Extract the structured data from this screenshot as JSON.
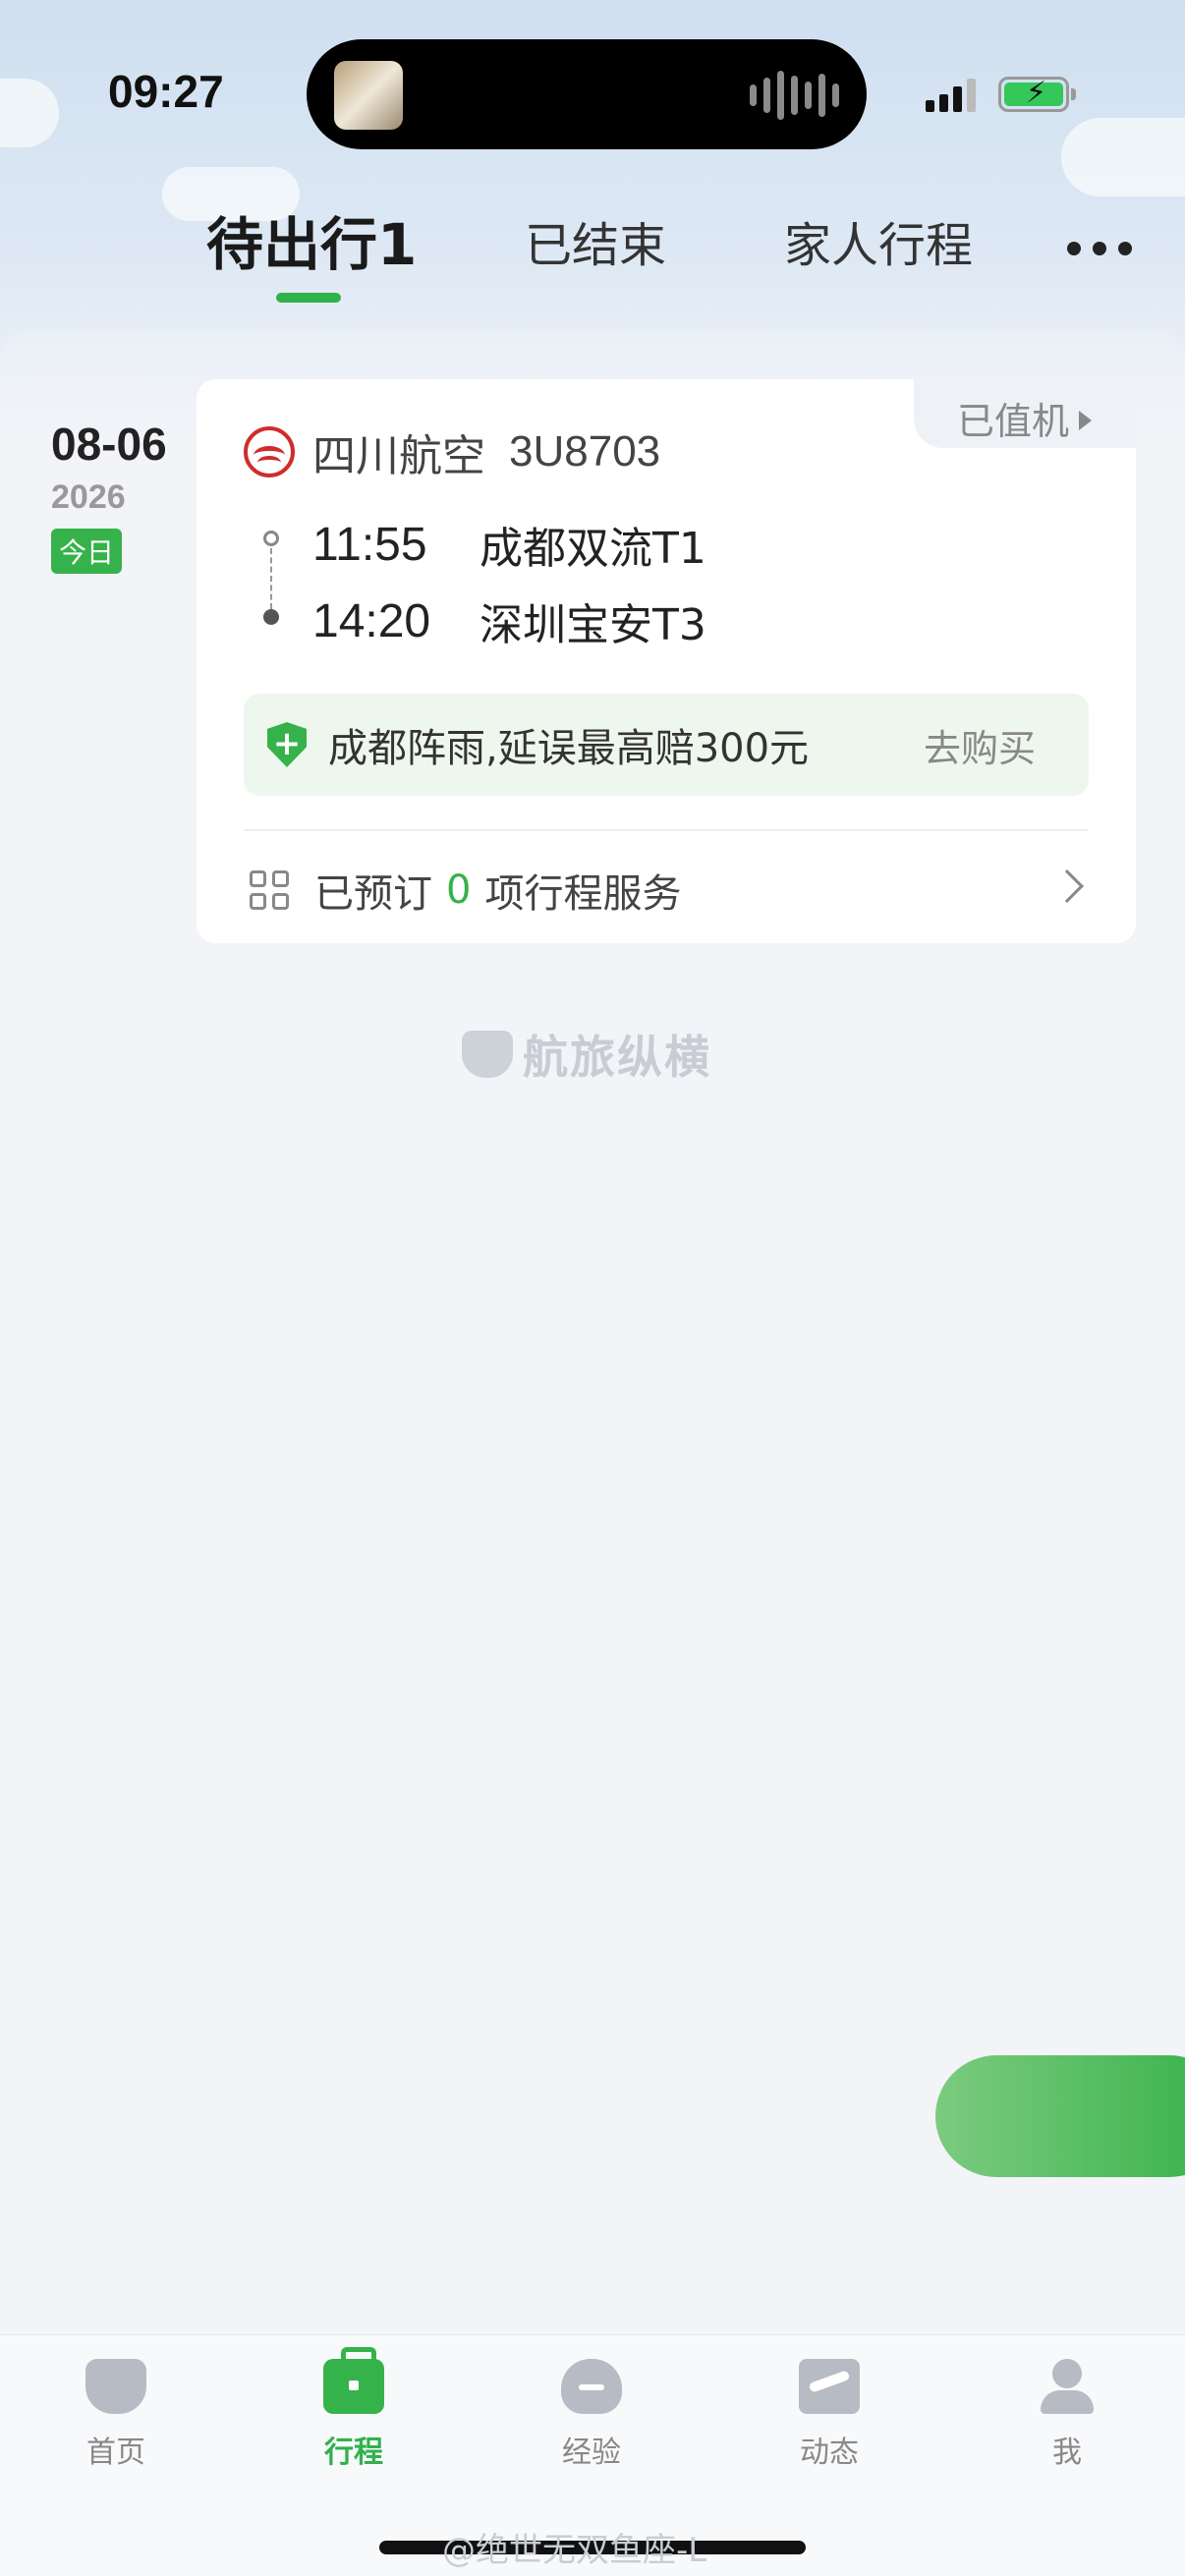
{
  "status_bar": {
    "time": "09:27",
    "signal": "signal-icon",
    "battery": "battery-charging-icon"
  },
  "tabs": [
    {
      "label": "待出行1",
      "active": true
    },
    {
      "label": "已结束",
      "active": false
    },
    {
      "label": "家人行程",
      "active": false
    }
  ],
  "more_icon": "more-dots-icon",
  "trip": {
    "date": "08-06",
    "year": "2026",
    "today_badge": "今日",
    "checkin_status": "已值机",
    "airline": "四川航空",
    "flight_no": "3U8703",
    "departure": {
      "time": "11:55",
      "airport": "成都双流T1"
    },
    "arrival": {
      "time": "14:20",
      "airport": "深圳宝安T3"
    },
    "insurance": {
      "text": "成都阵雨,延误最高赔300元",
      "action": "去购买"
    },
    "services": {
      "prefix": "已预订",
      "count": "0",
      "suffix": "项行程服务"
    }
  },
  "watermark": "航旅纵横",
  "bottom_nav": [
    {
      "label": "首页",
      "icon": "home-icon",
      "active": false
    },
    {
      "label": "行程",
      "icon": "trip-bag-icon",
      "active": true
    },
    {
      "label": "经验",
      "icon": "experience-icon",
      "active": false
    },
    {
      "label": "动态",
      "icon": "flight-status-icon",
      "active": false
    },
    {
      "label": "我",
      "icon": "profile-icon",
      "active": false
    }
  ],
  "credit": "@绝世无双鱼座-L",
  "colors": {
    "accent": "#36b24a",
    "airline_red": "#d02c2c"
  }
}
